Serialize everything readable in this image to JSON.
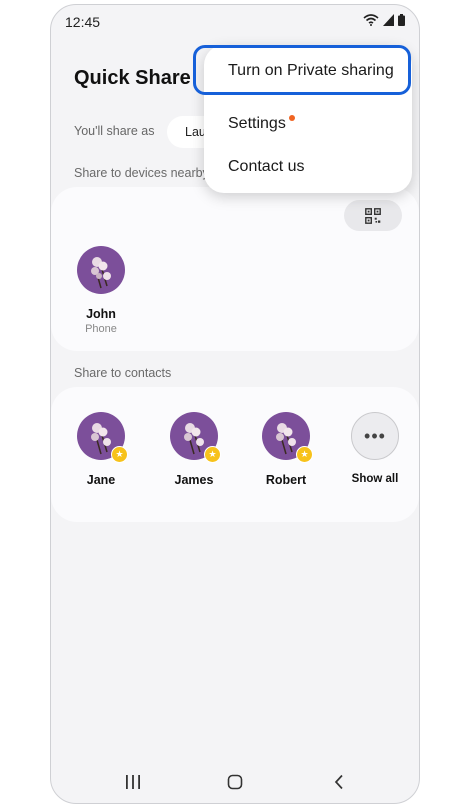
{
  "status": {
    "time": "12:45"
  },
  "app": {
    "title": "Quick Share"
  },
  "share_as": {
    "label": "You'll share as",
    "name": "Lau"
  },
  "nearby": {
    "label": "Share to devices nearby",
    "devices": [
      {
        "name": "John",
        "type": "Phone"
      }
    ]
  },
  "contacts": {
    "label": "Share to contacts",
    "people": [
      {
        "name": "Jane"
      },
      {
        "name": "James"
      },
      {
        "name": "Robert"
      }
    ],
    "show_all": "Show all",
    "more_glyph": "•••"
  },
  "menu": {
    "items": [
      {
        "label": "Turn on Private sharing"
      },
      {
        "label": "Settings"
      },
      {
        "label": "Contact us"
      }
    ]
  },
  "colors": {
    "highlight": "#1660d9",
    "notification_dot": "#f06422",
    "avatar_bg": "#7c4f9a",
    "favorite_star": "#f7c21b"
  },
  "icons": {
    "status": [
      "wifi-icon",
      "signal-icon",
      "battery-icon"
    ],
    "qr": "qr-code-icon",
    "nav": [
      "recents-icon",
      "home-icon",
      "back-icon"
    ]
  }
}
